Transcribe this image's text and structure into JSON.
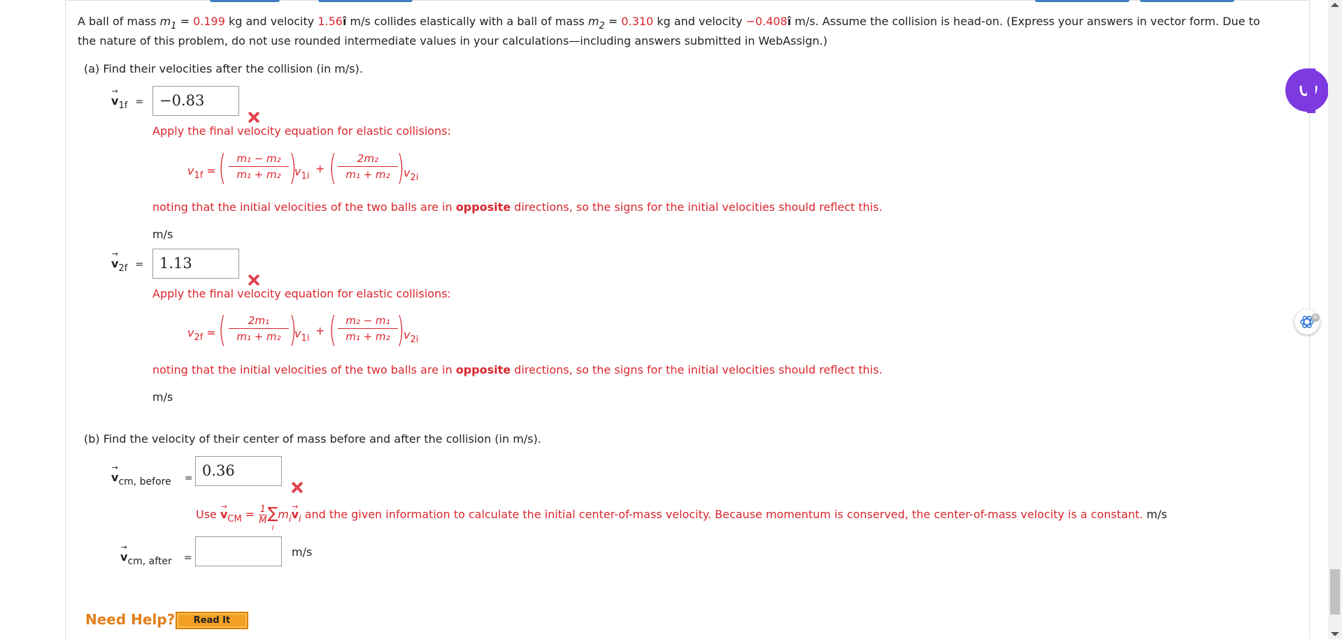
{
  "problem": {
    "p1": "A ball of mass",
    "m1_var": "m",
    "m1_sub": "1",
    "p2": " = ",
    "m1_value": "0.199",
    "p3": " kg and velocity ",
    "v1_value": "1.56",
    "ihat": "î",
    "p4": " m/s collides elastically with a ball of mass ",
    "m2_var": "m",
    "m2_sub": "2",
    "p5": " = ",
    "m2_value": "0.310",
    "p6": " kg and velocity ",
    "v2_value": "−0.408",
    "p7": " m/s. Assume the collision is head-on. (Express your answers in vector form. Due to",
    "line2": "the nature of this problem, do not use rounded intermediate values in your calculations—including answers submitted in WebAssign.)"
  },
  "part_a": {
    "prompt": "(a)  Find their velocities after the collision (in m/s).",
    "v1f": {
      "sym": "v",
      "sub": "1f",
      "eq": "=",
      "answer": "−0.83",
      "hint": "Apply the final velocity equation for elastic collisions:",
      "lhs": "v",
      "lhs_sub": "1f",
      "f1_num": "m₁ − m₂",
      "f1_den": "m₁ + m₂",
      "t1": "v",
      "t1_sub": "1i",
      "plus": "+",
      "f2_num": "2m₂",
      "f2_den": "m₁ + m₂",
      "t2": "v",
      "t2_sub": "2i",
      "note_a": "noting that the initial velocities of the two balls are in ",
      "note_bold": "opposite",
      "note_b": " directions, so the signs for the initial velocities should reflect this.",
      "unit": "m/s"
    },
    "v2f": {
      "sym": "v",
      "sub": "2f",
      "eq": "=",
      "answer": "1.13",
      "hint": "Apply the final velocity equation for elastic collisions:",
      "lhs": "v",
      "lhs_sub": "2f",
      "f1_num": "2m₁",
      "f1_den": "m₁ + m₂",
      "t1": "v",
      "t1_sub": "1i",
      "plus": "+",
      "f2_num": "m₂ − m₁",
      "f2_den": "m₁ + m₂",
      "t2": "v",
      "t2_sub": "2i",
      "note_a": "noting that the initial velocities of the two balls are in ",
      "note_bold": "opposite",
      "note_b": " directions, so the signs for the initial velocities should reflect this.",
      "unit": "m/s"
    }
  },
  "part_b": {
    "prompt": "(b)  Find the velocity of their center of mass before and after the collision (in m/s).",
    "before": {
      "sym": "v",
      "sub": "cm, before",
      "eq": "=",
      "answer": "0.36",
      "hint_use": "Use ",
      "hint_v": "v",
      "hint_vsub": "CM",
      "hint_eq": " = ",
      "frac_num": "1",
      "frac_den": "M",
      "sigma": "∑",
      "sigma_sub": "i",
      "hint_m": "m",
      "hint_msub": "i",
      "hint_vi": "v",
      "hint_visub": "i",
      "hint_rest": " and the given information to calculate the initial center-of-mass velocity. Because momentum is conserved, the center-of-mass velocity is a constant.",
      "unit": "m/s"
    },
    "after": {
      "sym": "v",
      "sub": "cm, after",
      "eq": "=",
      "answer": "",
      "unit": "m/s"
    }
  },
  "help": {
    "label": "Need Help?",
    "read_it": "Read It"
  },
  "colors": {
    "given_value": "#d9262c",
    "feedback": "#d9262c",
    "help": "#e37e1b",
    "assistant": "#7d3ae0"
  },
  "icons": [
    "incorrect-x-icon",
    "assistant-icon",
    "chatgpt-icon"
  ]
}
